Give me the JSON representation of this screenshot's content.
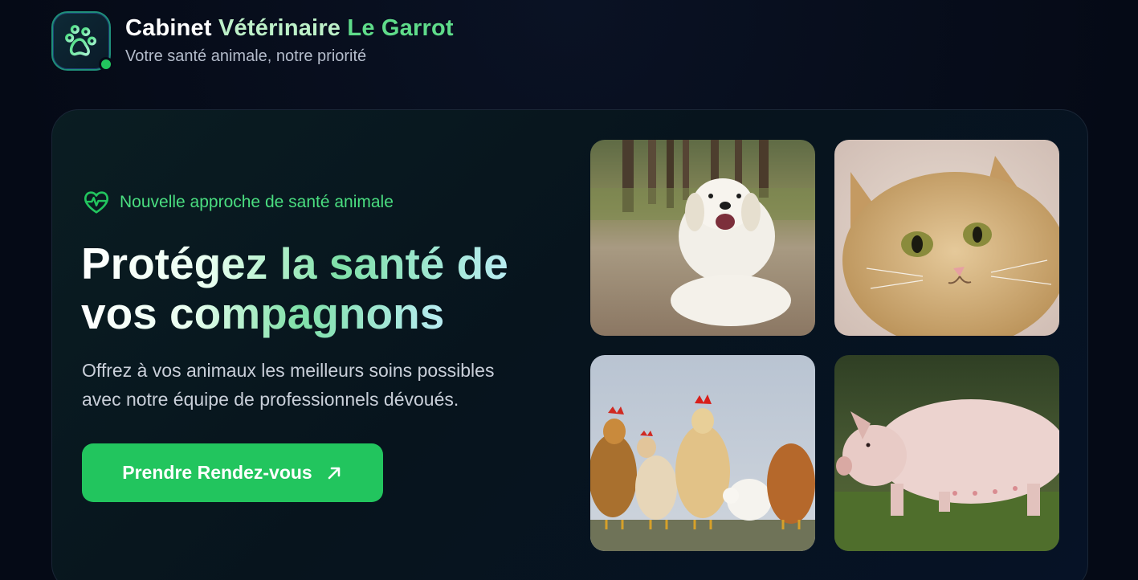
{
  "header": {
    "title_word_1": "Cabinet",
    "title_word_2": "Vétérinaire",
    "title_word_3": "Le Garrot",
    "subtitle": "Votre santé animale, notre priorité",
    "logo_icon": "paw-icon"
  },
  "hero": {
    "badge_icon": "heart-pulse-icon",
    "badge_text": "Nouvelle approche de santé animale",
    "headline_line_1": "Protégez la santé de",
    "headline_line_2": "vos compagnons",
    "description_line_1": "Offrez à vos animaux les meilleurs soins possibles",
    "description_line_2": "avec notre équipe de professionnels dévoués.",
    "cta_label": "Prendre Rendez-vous",
    "cta_icon": "arrow-up-right-icon"
  },
  "gallery": {
    "images": [
      "dog",
      "cat",
      "chickens",
      "pig"
    ]
  },
  "colors": {
    "accent": "#22c55e",
    "accent_text": "#4ade80",
    "background": "#060b18"
  }
}
